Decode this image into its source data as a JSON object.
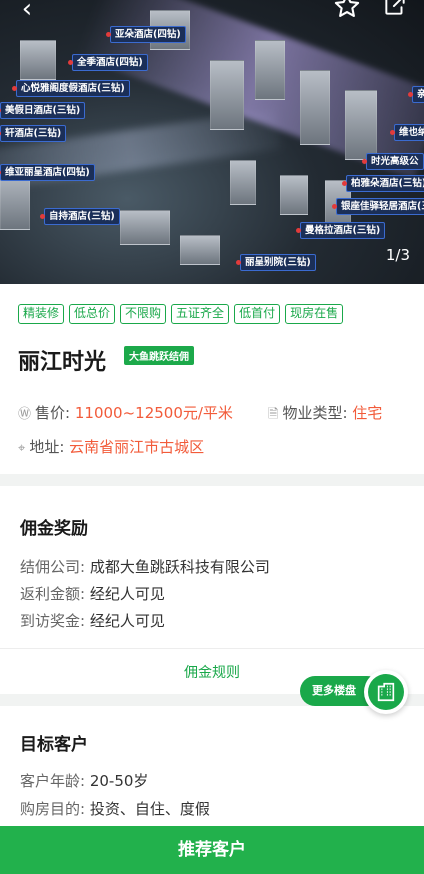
{
  "hero": {
    "image_counter": "1/3",
    "icons": {
      "back": "back-arrow-icon",
      "favorite": "star-icon",
      "share": "share-icon"
    },
    "labels": [
      "亚朵酒店(四钻)",
      "全季酒店(四钻)",
      "心悦雅阁度假酒店(三钻)",
      "美假日酒店(三钻)",
      "轩酒店(三钻)",
      "维亚丽呈酒店(四钻)",
      "自持酒店(三钻)",
      "丽呈别院(三钻)",
      "曼格拉酒店(三钻)",
      "银座佳驿轻居酒店(三",
      "柏雅朵酒店(三钻)",
      "时光高级公",
      "维也纳",
      "亲"
    ]
  },
  "info": {
    "tags": [
      "精装修",
      "低总价",
      "不限购",
      "五证齐全",
      "低首付",
      "现房在售"
    ],
    "title": "丽江时光",
    "badge": "大鱼跳跃结佣",
    "price_label": "售价:",
    "price_value": "11000~12500元/平米",
    "type_label": "物业类型:",
    "type_value": "住宅",
    "address_label": "地址:",
    "address_value": "云南省丽江市古城区"
  },
  "commission": {
    "title": "佣金奖励",
    "company_label": "结佣公司:",
    "company_value": "成都大鱼跳跃科技有限公司",
    "rebate_label": "返利金额:",
    "rebate_value": "经纪人可见",
    "visit_label": "到访奖金:",
    "visit_value": "经纪人可见",
    "rules_link": "佣金规则"
  },
  "more_button": {
    "label": "更多楼盘",
    "icon": "building-icon"
  },
  "target": {
    "title": "目标客户",
    "age_label": "客户年龄:",
    "age_value": "20-50岁",
    "purpose_label": "购房目的:",
    "purpose_value": "投资、自住、度假"
  },
  "footer": {
    "recommend_label": "推荐客户"
  },
  "colors": {
    "accent": "#1aa84a",
    "price": "#f25b3a",
    "button": "#22b14c"
  }
}
